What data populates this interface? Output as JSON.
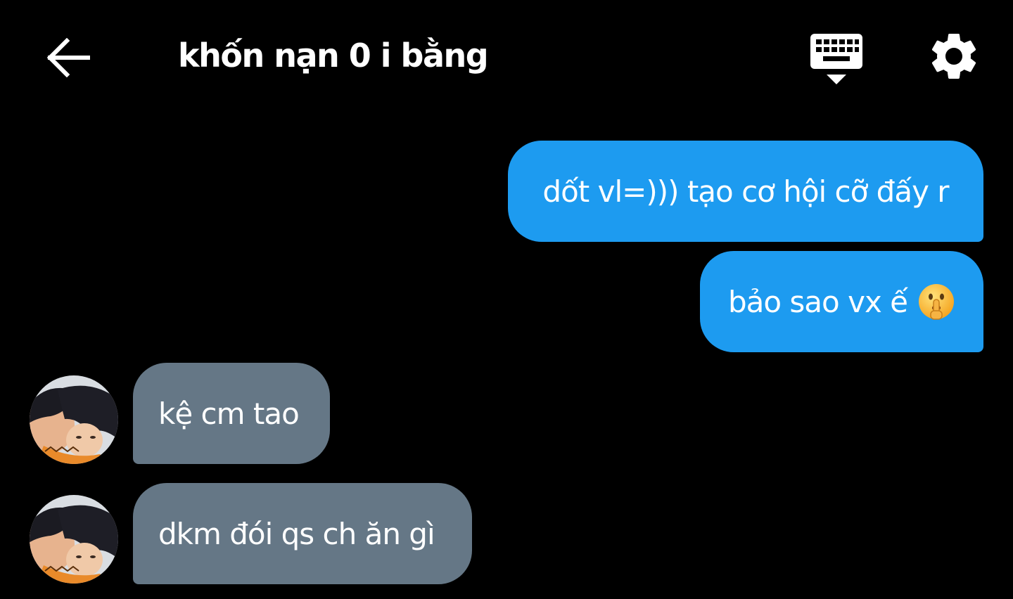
{
  "header": {
    "title": "khốn nạn 0 i bằng",
    "back_icon": "arrow-left-icon",
    "keyboard_icon": "keyboard-hide-icon",
    "settings_icon": "gear-icon"
  },
  "messages": [
    {
      "direction": "outgoing",
      "text": "dốt vl=))) tạo cơ hội cỡ đấy r"
    },
    {
      "direction": "outgoing",
      "text": "bảo sao vx ế",
      "emoji": "shushing-face-emoji"
    },
    {
      "direction": "incoming",
      "text": "kệ cm tao",
      "avatar": "contact-avatar"
    },
    {
      "direction": "incoming",
      "text": "dkm đói qs ch ăn gì",
      "avatar": "contact-avatar"
    }
  ],
  "colors": {
    "background": "#000000",
    "outgoing_bubble": "#1d9bf0",
    "incoming_bubble": "#657786",
    "text": "#ffffff"
  }
}
